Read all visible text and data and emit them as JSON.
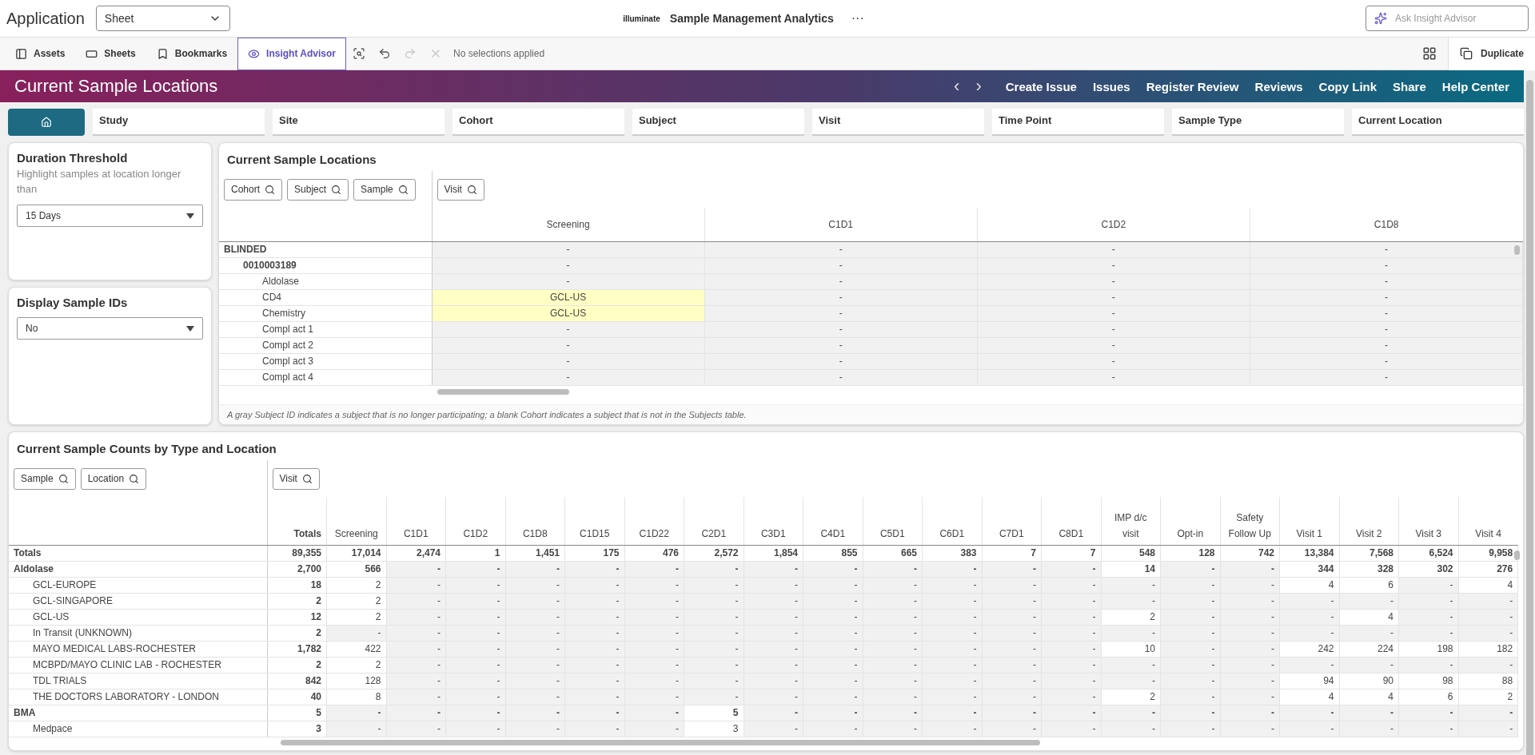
{
  "header": {
    "app_label": "Application",
    "sheet_select": "Sheet",
    "logo_text": "illuminate",
    "title": "Sample Management Analytics",
    "more": "···",
    "ask_placeholder": "Ask Insight Advisor"
  },
  "toolbar": {
    "items": [
      {
        "label": "Assets",
        "kind": "assets",
        "selected": false
      },
      {
        "label": "Sheets",
        "kind": "sheets",
        "selected": false
      },
      {
        "label": "Bookmarks",
        "kind": "bookmarks",
        "selected": false
      },
      {
        "label": "Insight Advisor",
        "kind": "insight",
        "selected": true
      }
    ],
    "selection_tools": [
      {
        "kind": "search",
        "disabled": false
      },
      {
        "kind": "back",
        "disabled": false
      },
      {
        "kind": "forward",
        "disabled": true
      },
      {
        "kind": "clear",
        "disabled": true
      }
    ],
    "selection_status": "No selections applied",
    "duplicate": "Duplicate"
  },
  "banner": {
    "title": "Current Sample Locations",
    "prev": "‹",
    "next": "›",
    "links": [
      "Create Issue",
      "Issues",
      "Register Review",
      "Reviews",
      "Copy Link",
      "Share",
      "Help Center"
    ]
  },
  "filters": [
    "Study",
    "Site",
    "Cohort",
    "Subject",
    "Visit",
    "Time Point",
    "Sample Type",
    "Current Location"
  ],
  "side_panels": [
    {
      "title": "Duration Threshold",
      "subtitle": "Highlight samples at location longer than",
      "value": "15 Days"
    },
    {
      "title": "Display Sample IDs",
      "value": "No"
    }
  ],
  "locations_table": {
    "title": "Current Sample Locations",
    "row_filters": [
      "Cohort",
      "Subject",
      "Sample"
    ],
    "column_filters": [
      "Visit"
    ],
    "columns": [
      "Screening",
      "C1D1",
      "C1D2",
      "C1D8"
    ],
    "rows": [
      {
        "label": "BLINDED",
        "cells": [
          {
            "text": "-",
            "highlighted": false
          },
          {
            "text": "-",
            "highlighted": false
          },
          {
            "text": "-",
            "highlighted": false
          },
          {
            "text": "-",
            "highlighted": false
          }
        ],
        "children": [
          {
            "label": "0010003189",
            "cells": [
              {
                "text": "-",
                "highlighted": false
              },
              {
                "text": "-",
                "highlighted": false
              },
              {
                "text": "-",
                "highlighted": false
              },
              {
                "text": "-",
                "highlighted": false
              }
            ],
            "children": [
              {
                "label": "Aldolase",
                "cells": [
                  {
                    "text": "-",
                    "highlighted": false
                  },
                  {
                    "text": "-",
                    "highlighted": false
                  },
                  {
                    "text": "-",
                    "highlighted": false
                  },
                  {
                    "text": "-",
                    "highlighted": false
                  }
                ]
              },
              {
                "label": "CD4",
                "cells": [
                  {
                    "text": "GCL-US",
                    "highlighted": true
                  },
                  {
                    "text": "-",
                    "highlighted": false
                  },
                  {
                    "text": "-",
                    "highlighted": false
                  },
                  {
                    "text": "-",
                    "highlighted": false
                  }
                ]
              },
              {
                "label": "Chemistry",
                "cells": [
                  {
                    "text": "GCL-US",
                    "highlighted": true
                  },
                  {
                    "text": "-",
                    "highlighted": false
                  },
                  {
                    "text": "-",
                    "highlighted": false
                  },
                  {
                    "text": "-",
                    "highlighted": false
                  }
                ]
              },
              {
                "label": "Compl act 1",
                "cells": [
                  {
                    "text": "-",
                    "highlighted": false
                  },
                  {
                    "text": "-",
                    "highlighted": false
                  },
                  {
                    "text": "-",
                    "highlighted": false
                  },
                  {
                    "text": "-",
                    "highlighted": false
                  }
                ]
              },
              {
                "label": "Compl act 2",
                "cells": [
                  {
                    "text": "-",
                    "highlighted": false
                  },
                  {
                    "text": "-",
                    "highlighted": false
                  },
                  {
                    "text": "-",
                    "highlighted": false
                  },
                  {
                    "text": "-",
                    "highlighted": false
                  }
                ]
              },
              {
                "label": "Compl act 3",
                "cells": [
                  {
                    "text": "-",
                    "highlighted": false
                  },
                  {
                    "text": "-",
                    "highlighted": false
                  },
                  {
                    "text": "-",
                    "highlighted": false
                  },
                  {
                    "text": "-",
                    "highlighted": false
                  }
                ]
              },
              {
                "label": "Compl act 4",
                "cells": [
                  {
                    "text": "-",
                    "highlighted": false
                  },
                  {
                    "text": "-",
                    "highlighted": false
                  },
                  {
                    "text": "-",
                    "highlighted": false
                  },
                  {
                    "text": "-",
                    "highlighted": false
                  }
                ]
              }
            ]
          }
        ]
      }
    ],
    "footnote": "A gray Subject ID indicates a subject that is no longer participating; a blank Cohort indicates a subject that is not in the Subjects table."
  },
  "counts_table": {
    "title": "Current Sample Counts by Type and Location",
    "row_filters": [
      "Sample",
      "Location"
    ],
    "column_filters": [
      "Visit"
    ],
    "columns": [
      "Totals",
      "Screening",
      "C1D1",
      "C1D2",
      "C1D8",
      "C1D15",
      "C1D22",
      "C2D1",
      "C3D1",
      "C4D1",
      "C5D1",
      "C6D1",
      "C7D1",
      "C8D1",
      "IMP d/c visit",
      "Opt-in",
      "Safety Follow Up",
      "Visit 1",
      "Visit 2",
      "Visit 3",
      "Visit 4"
    ],
    "totals": {
      "label": "Totals",
      "cells": [
        "89,355",
        "17,014",
        "2,474",
        "1",
        "1,451",
        "175",
        "476",
        "2,572",
        "1,854",
        "855",
        "665",
        "383",
        "7",
        "7",
        "548",
        "128",
        "742",
        "13,384",
        "7,568",
        "6,524",
        "9,958"
      ]
    },
    "rows": [
      {
        "label": "Aldolase",
        "cells": [
          "2,700",
          "566",
          "-",
          "-",
          "-",
          "-",
          "-",
          "-",
          "-",
          "-",
          "-",
          "-",
          "-",
          "-",
          "14",
          "-",
          "-",
          "344",
          "328",
          "302",
          "276"
        ],
        "children": [
          {
            "label": "GCL-EUROPE",
            "cells": [
              "18",
              "2",
              "-",
              "-",
              "-",
              "-",
              "-",
              "-",
              "-",
              "-",
              "-",
              "-",
              "-",
              "-",
              "-",
              "-",
              "-",
              "4",
              "6",
              "-",
              "4"
            ]
          },
          {
            "label": "GCL-SINGAPORE",
            "cells": [
              "2",
              "2",
              "-",
              "-",
              "-",
              "-",
              "-",
              "-",
              "-",
              "-",
              "-",
              "-",
              "-",
              "-",
              "-",
              "-",
              "-",
              "-",
              "-",
              "-",
              "-"
            ]
          },
          {
            "label": "GCL-US",
            "cells": [
              "12",
              "2",
              "-",
              "-",
              "-",
              "-",
              "-",
              "-",
              "-",
              "-",
              "-",
              "-",
              "-",
              "-",
              "2",
              "-",
              "-",
              "-",
              "4",
              "-",
              "-"
            ]
          },
          {
            "label": "In Transit (UNKNOWN)",
            "cells": [
              "2",
              "-",
              "-",
              "-",
              "-",
              "-",
              "-",
              "-",
              "-",
              "-",
              "-",
              "-",
              "-",
              "-",
              "-",
              "-",
              "-",
              "-",
              "-",
              "-",
              "-"
            ]
          },
          {
            "label": "MAYO MEDICAL LABS-ROCHESTER",
            "cells": [
              "1,782",
              "422",
              "-",
              "-",
              "-",
              "-",
              "-",
              "-",
              "-",
              "-",
              "-",
              "-",
              "-",
              "-",
              "10",
              "-",
              "-",
              "242",
              "224",
              "198",
              "182"
            ]
          },
          {
            "label": "MCBPD/MAYO CLINIC LAB - ROCHESTER",
            "cells": [
              "2",
              "2",
              "-",
              "-",
              "-",
              "-",
              "-",
              "-",
              "-",
              "-",
              "-",
              "-",
              "-",
              "-",
              "-",
              "-",
              "-",
              "-",
              "-",
              "-",
              "-"
            ]
          },
          {
            "label": "TDL TRIALS",
            "cells": [
              "842",
              "128",
              "-",
              "-",
              "-",
              "-",
              "-",
              "-",
              "-",
              "-",
              "-",
              "-",
              "-",
              "-",
              "-",
              "-",
              "-",
              "94",
              "90",
              "98",
              "88"
            ]
          },
          {
            "label": "THE DOCTORS LABORATORY - LONDON",
            "cells": [
              "40",
              "8",
              "-",
              "-",
              "-",
              "-",
              "-",
              "-",
              "-",
              "-",
              "-",
              "-",
              "-",
              "-",
              "2",
              "-",
              "-",
              "4",
              "4",
              "6",
              "2"
            ]
          }
        ]
      },
      {
        "label": "BMA",
        "cells": [
          "5",
          "-",
          "-",
          "-",
          "-",
          "-",
          "-",
          "5",
          "-",
          "-",
          "-",
          "-",
          "-",
          "-",
          "-",
          "-",
          "-",
          "-",
          "-",
          "-",
          "-"
        ],
        "children": [
          {
            "label": "Medpace",
            "cells": [
              "3",
              "-",
              "-",
              "-",
              "-",
              "-",
              "-",
              "3",
              "-",
              "-",
              "-",
              "-",
              "-",
              "-",
              "-",
              "-",
              "-",
              "-",
              "-",
              "-",
              "-"
            ]
          }
        ]
      }
    ]
  }
}
